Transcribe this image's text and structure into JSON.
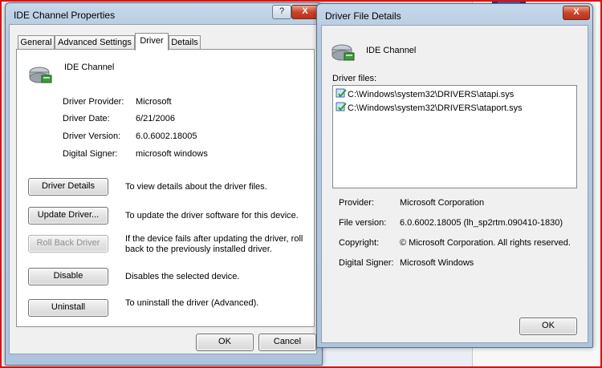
{
  "left_window": {
    "title": "IDE Channel Properties",
    "help_button": "?",
    "close_button": "X",
    "tabs": [
      {
        "label": "General"
      },
      {
        "label": "Advanced Settings"
      },
      {
        "label": "Driver"
      },
      {
        "label": "Details"
      }
    ],
    "device_name": "IDE Channel",
    "info": {
      "provider_label": "Driver Provider:",
      "provider_value": "Microsoft",
      "date_label": "Driver Date:",
      "date_value": "6/21/2006",
      "version_label": "Driver Version:",
      "version_value": "6.0.6002.18005",
      "signer_label": "Digital Signer:",
      "signer_value": "microsoft windows"
    },
    "actions": [
      {
        "button": "Driver Details",
        "desc": "To view details about the driver files."
      },
      {
        "button": "Update Driver...",
        "desc": "To update the driver software for this device."
      },
      {
        "button": "Roll Back Driver",
        "desc": "If the device fails after updating the driver, roll back to the previously installed driver."
      },
      {
        "button": "Disable",
        "desc": "Disables the selected device."
      },
      {
        "button": "Uninstall",
        "desc": "To uninstall the driver (Advanced)."
      }
    ],
    "ok_button": "OK",
    "cancel_button": "Cancel"
  },
  "right_window": {
    "title": "Driver File Details",
    "device_name": "IDE Channel",
    "files_label": "Driver files:",
    "files": [
      {
        "path": "C:\\Windows\\system32\\DRIVERS\\atapi.sys"
      },
      {
        "path": "C:\\Windows\\system32\\DRIVERS\\ataport.sys"
      }
    ],
    "details": {
      "provider_label": "Provider:",
      "provider_value": "Microsoft Corporation",
      "version_label": "File version:",
      "version_value": "6.0.6002.18005 (lh_sp2rtm.090410-1830)",
      "copyright_label": "Copyright:",
      "copyright_value": "© Microsoft Corporation. All rights reserved.",
      "signer_label": "Digital Signer:",
      "signer_value": "Microsoft Windows"
    },
    "ok_button": "OK",
    "close_button": "X"
  },
  "icons": {
    "device": "ide-drive-icon",
    "file": "signed-driver-file-icon"
  },
  "colors": {
    "window_frame": "#aec4da",
    "close_red": "#c9452a",
    "border_highlight": "#e01010"
  }
}
